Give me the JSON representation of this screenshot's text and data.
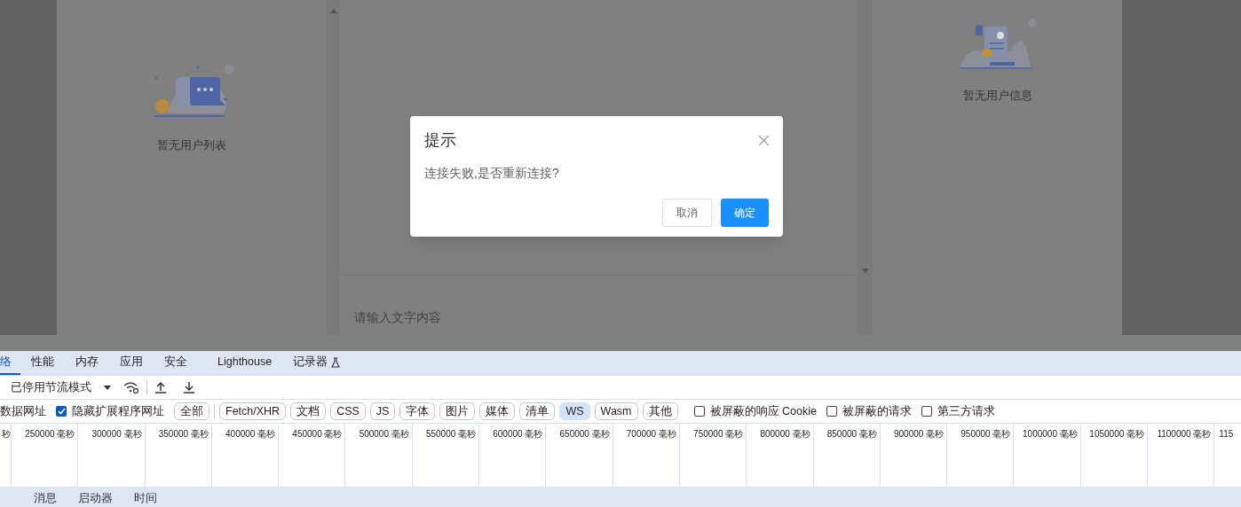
{
  "app": {
    "user_list_empty": "暂无用户列表",
    "user_info_empty": "暂无用户信息",
    "message_input": {
      "placeholder": "请输入文字内容"
    }
  },
  "dialog": {
    "title": "提示",
    "message": "连接失败,是否重新连接?",
    "buttons": [
      {
        "label": "取消",
        "kind": "secondary"
      },
      {
        "label": "确定",
        "kind": "primary"
      }
    ]
  },
  "devtools": {
    "tabs": [
      {
        "label": "络",
        "selected": true
      },
      {
        "label": "性能",
        "selected": false
      },
      {
        "label": "内存",
        "selected": false
      },
      {
        "label": "应用",
        "selected": false
      },
      {
        "label": "安全",
        "selected": false
      },
      {
        "label": "Lighthouse",
        "selected": false
      },
      {
        "label": "记录器",
        "selected": false
      }
    ],
    "throttling": "已停用节流模式",
    "filter_cut_label": "数据网址",
    "filter_options": [
      {
        "label": "隐藏扩展程序网址",
        "checked": true
      }
    ],
    "type_filters": [
      {
        "label": "全部",
        "selected": false
      },
      {
        "label": "Fetch/XHR",
        "selected": false
      },
      {
        "label": "文档",
        "selected": false
      },
      {
        "label": "CSS",
        "selected": false
      },
      {
        "label": "JS",
        "selected": false
      },
      {
        "label": "字体",
        "selected": false
      },
      {
        "label": "图片",
        "selected": false
      },
      {
        "label": "媒体",
        "selected": false
      },
      {
        "label": "清单",
        "selected": false
      },
      {
        "label": "WS",
        "selected": true
      },
      {
        "label": "Wasm",
        "selected": false
      },
      {
        "label": "其他",
        "selected": false
      }
    ],
    "extra_filters": [
      {
        "label": "被屏蔽的响应 Cookie",
        "checked": false
      },
      {
        "label": "被屏蔽的请求",
        "checked": false
      },
      {
        "label": "第三方请求",
        "checked": false
      }
    ],
    "timeline_ticks": [
      "秒",
      "250000 毫秒",
      "300000 毫秒",
      "350000 毫秒",
      "400000 毫秒",
      "450000 毫秒",
      "500000 毫秒",
      "550000 毫秒",
      "600000 毫秒",
      "650000 毫秒",
      "700000 毫秒",
      "750000 毫秒",
      "800000 毫秒",
      "850000 毫秒",
      "900000 毫秒",
      "950000 毫秒",
      "1000000 毫秒",
      "1050000 毫秒",
      "1100000 毫秒",
      "115"
    ],
    "bottom_tabs": [
      "消息",
      "启动器",
      "时间"
    ]
  }
}
